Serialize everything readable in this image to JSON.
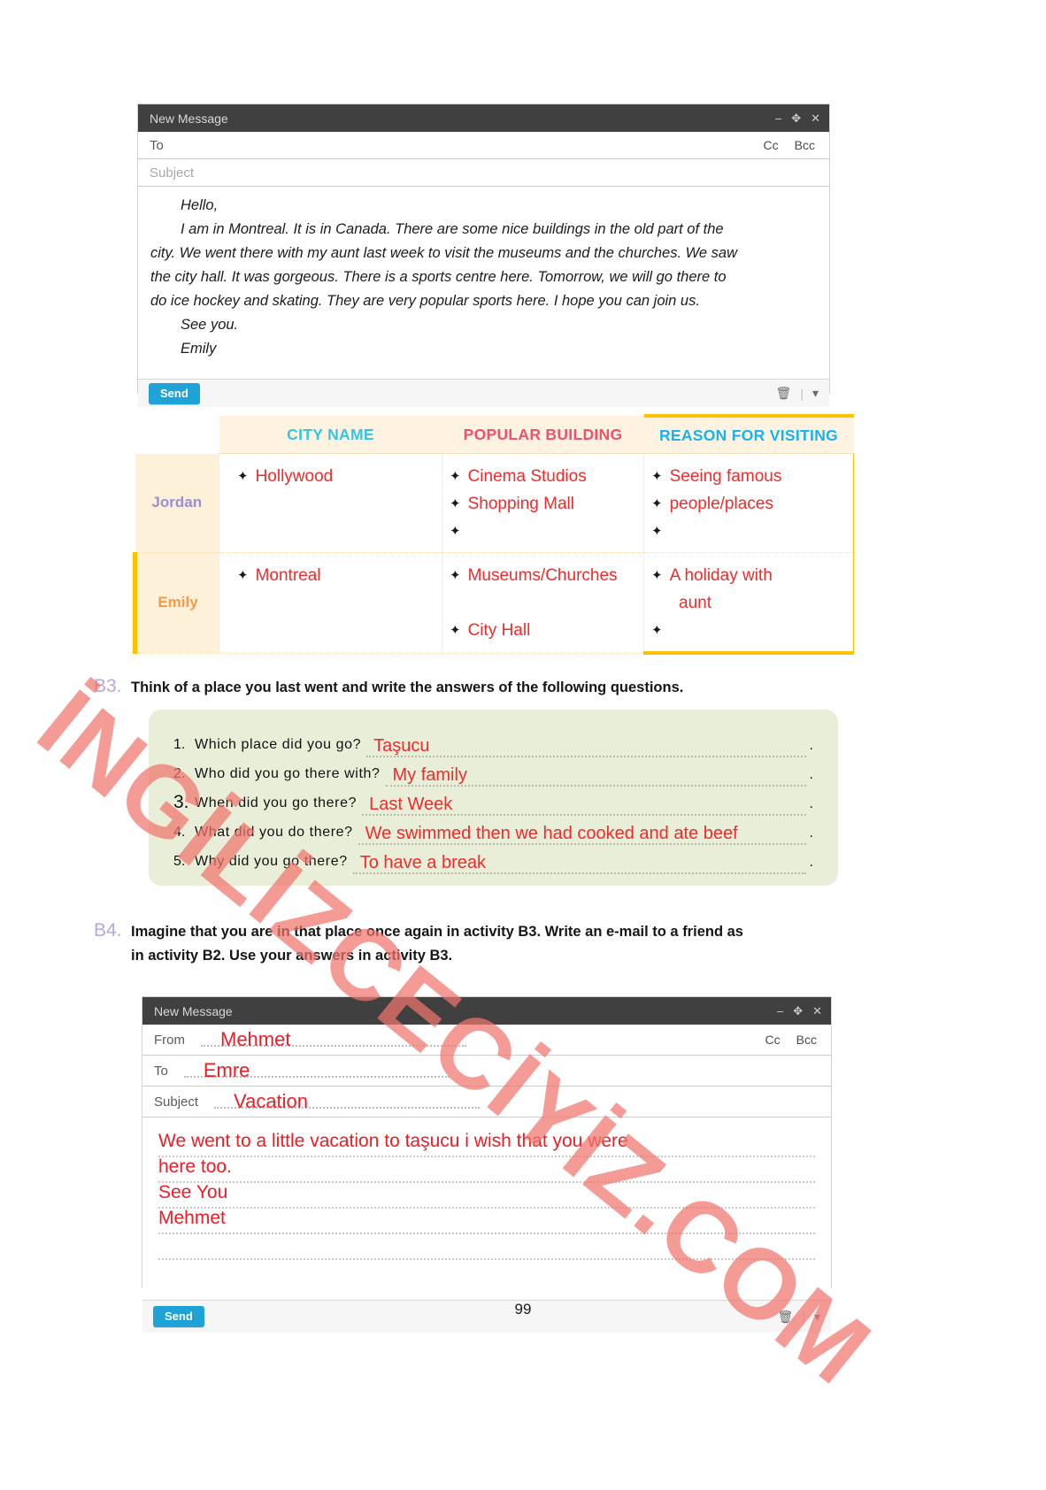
{
  "page_number": "99",
  "watermark": "İNGİLİZCECİYİZ.COM",
  "top_email": {
    "title": "New Message",
    "window_buttons": [
      "minimize",
      "expand",
      "close"
    ],
    "to_label": "To",
    "cc_label": "Cc",
    "bcc_label": "Bcc",
    "subject_placeholder": "Subject",
    "body_lines": [
      "Hello,",
      "I am in Montreal. It is in Canada. There are some nice buildings in the old part of the",
      "city. We went there with my aunt last week to visit the museums and the churches. We saw",
      "the city hall. It was gorgeous. There is a sports centre here. Tomorrow, we will go there to",
      "do ice hockey and skating. They are very popular sports here. I hope you can join us.",
      "See you.",
      "Emily"
    ],
    "send_label": "Send",
    "trash_icon": "trash-icon",
    "more_icon": "chevron-down-icon"
  },
  "table": {
    "headers": [
      "",
      "CITY NAME",
      "POPULAR BUILDING",
      "REASON FOR VISITING"
    ],
    "header_colors": {
      "city": "#34c6e0",
      "building": "#f2506b",
      "reason": "#19b3ee",
      "accent_bar": "#fcc200"
    },
    "rows": [
      {
        "name": "Jordan",
        "name_color": "#9a8fd0",
        "city": [
          "Hollywood"
        ],
        "building": [
          "Cinema Studios",
          "Shopping Mall",
          ""
        ],
        "reason": [
          "Seeing famous",
          "people/places",
          ""
        ]
      },
      {
        "name": "Emily",
        "name_color": "#f49a4a",
        "city": [
          "Montreal"
        ],
        "building": [
          "Museums/Churches",
          "City Hall"
        ],
        "reason": [
          "A holiday with",
          "aunt",
          ""
        ]
      }
    ]
  },
  "activity_b3": {
    "number": "B3.",
    "instruction": "Think of a place you last went and write the answers of the following questions.",
    "questions": [
      {
        "num": "1.",
        "text": "Which  place  did  you  go?",
        "answer": "Taşucu"
      },
      {
        "num": "2.",
        "text": "Who did you go there with?",
        "answer": "My family"
      },
      {
        "num": "3.",
        "text": "When  did  you  go  there?",
        "answer": "Last Week"
      },
      {
        "num": "4.",
        "text": "What did you do there?",
        "answer": "We swimmed then we had cooked and ate beef"
      },
      {
        "num": "5.",
        "text": "Why  did  you  go  there?",
        "answer": "To have a break"
      }
    ],
    "line_end": "."
  },
  "activity_b4": {
    "number": "B4.",
    "instruction_line1": "Imagine that you are in that place once again in activity B3. Write an e-mail to a friend as",
    "instruction_line2": "in activity B2. Use your answers in activity B3."
  },
  "bottom_email": {
    "title": "New Message",
    "from_label": "From",
    "from_value": "Mehmet",
    "to_label": "To",
    "to_value": "Emre",
    "subject_label": "Subject",
    "subject_value": "Vacation",
    "cc_label": "Cc",
    "bcc_label": "Bcc",
    "body_lines": [
      "We went to a little vacation to taşucu i wish that you were",
      "here too.",
      "See You",
      "Mehmet",
      ""
    ],
    "send_label": "Send",
    "trash_icon": "trash-icon",
    "more_icon": "chevron-down-icon"
  }
}
